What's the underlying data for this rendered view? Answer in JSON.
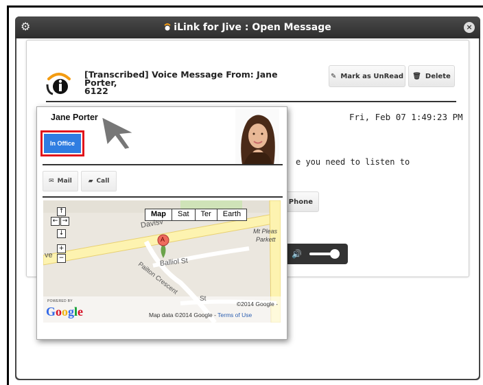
{
  "window": {
    "title": "iLink for Jive : Open Message",
    "close_symbol": "×"
  },
  "message": {
    "subject_line1": "[Transcribed] Voice Message From: Jane Porter,",
    "subject_line2": "6122",
    "mark_unread_label": "Mark as UnRead",
    "delete_label": "Delete",
    "date": "Fri, Feb 07 1:49:23 PM",
    "body_fragment": "e you need to listen to",
    "phone_label": "Phone"
  },
  "contact_card": {
    "name": "Jane Porter",
    "presence": "In Office",
    "presence_color": "#2f7de1",
    "highlight_color": "#e1121b",
    "mail_label": "Mail",
    "call_label": "Call"
  },
  "map": {
    "types": [
      "Map",
      "Sat",
      "Ter",
      "Earth"
    ],
    "nav": {
      "up": "↑",
      "left": "←",
      "right": "→",
      "down": "↓",
      "zoom_in": "+",
      "zoom_out": "−"
    },
    "streets": {
      "davis": "Davisv",
      "mt_pleasant": "Mt Pleas",
      "parkett": "Parkett",
      "ave": "ve",
      "balliol": "Balliol St",
      "pailton": "Pailton Crescent",
      "st": "St"
    },
    "marker_label": "A",
    "powered_by": "POWERED BY",
    "google_logo": "Google",
    "copyright": "©2014 Google -",
    "map_data": "Map data ©2014 Google -",
    "terms": "Terms of Use"
  }
}
